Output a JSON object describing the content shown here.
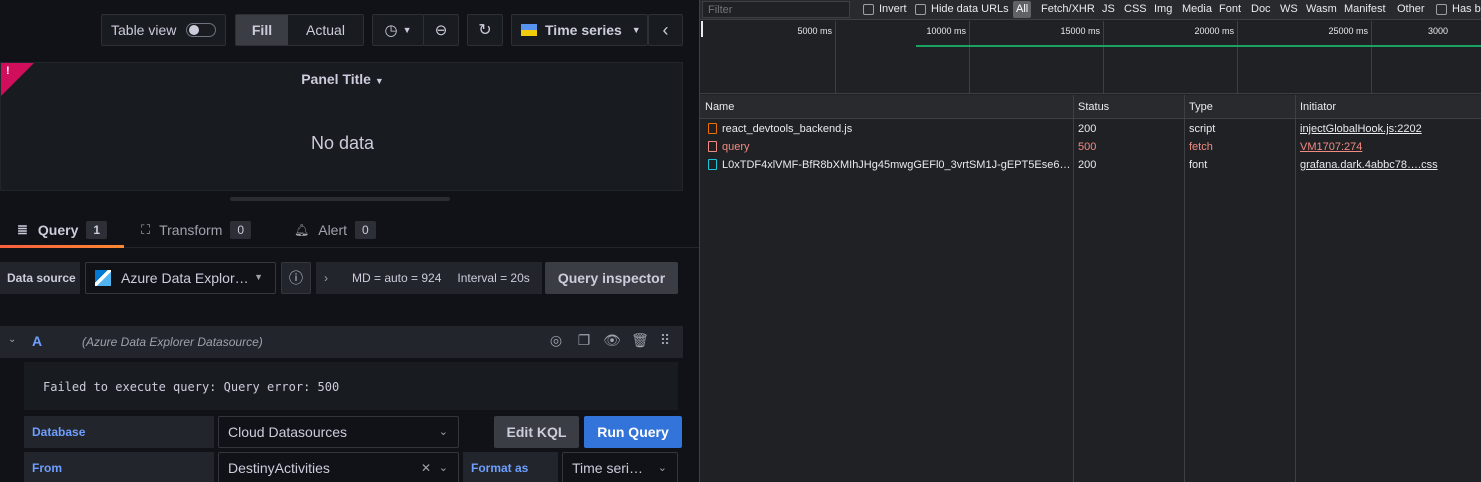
{
  "grafana": {
    "toolbar": {
      "table_view_label": "Table view",
      "fill_label": "Fill",
      "actual_label": "Actual",
      "viz_label": "Time series",
      "chevron_left": "‹"
    },
    "panel": {
      "error_mark": "!",
      "title": "Panel Title",
      "no_data": "No data"
    },
    "tabs": [
      {
        "label": "Query",
        "count": "1"
      },
      {
        "label": "Transform",
        "count": "0"
      },
      {
        "label": "Alert",
        "count": "0"
      }
    ],
    "datasource": {
      "label": "Data source",
      "selected": "Azure Data Explor…",
      "md": "MD = auto = 924",
      "interval": "Interval = 20s",
      "query_inspector": "Query inspector"
    },
    "query_row": {
      "letter": "A",
      "datasource_name": "(Azure Data Explorer Datasource)"
    },
    "error_message": "Failed to execute query: Query error: 500",
    "fields": {
      "database_label": "Database",
      "database_value": "Cloud Datasources",
      "edit_kql": "Edit KQL",
      "run_query": "Run Query",
      "from_label": "From",
      "from_value": "DestinyActivities",
      "clear_mark": "✕",
      "format_as_label": "Format as",
      "format_as_value": "Time seri…"
    },
    "colors": {
      "accent_blue": "#3274d9",
      "error_pink": "#d10e5c",
      "tab_orange": "#f55f3e"
    }
  },
  "devtools": {
    "filter": {
      "placeholder": "Filter",
      "invert": "Invert",
      "hide_data_urls": "Hide data URLs",
      "types": [
        "All",
        "Fetch/XHR",
        "JS",
        "CSS",
        "Img",
        "Media",
        "Font",
        "Doc",
        "WS",
        "Wasm",
        "Manifest",
        "Other"
      ],
      "has_blocked": "Has bl"
    },
    "timeline": {
      "ticks": [
        "5000 ms",
        "10000 ms",
        "15000 ms",
        "20000 ms",
        "25000 ms",
        "3000"
      ]
    },
    "table": {
      "headers": [
        "Name",
        "Status",
        "Type",
        "Initiator"
      ],
      "rows": [
        {
          "name": "react_devtools_backend.js",
          "status": "200",
          "type": "script",
          "initiator": "injectGlobalHook.js:2202",
          "icon": "script-icon",
          "error": false
        },
        {
          "name": "query",
          "status": "500",
          "type": "fetch",
          "initiator": "VM1707:274",
          "icon": "fetch-icon",
          "error": true
        },
        {
          "name": "L0xTDF4xlVMF-BfR8bXMIhJHg45mwgGEFl0_3vrtSM1J-gEPT5Ese6…",
          "status": "200",
          "type": "font",
          "initiator": "grafana.dark.4abbc78….css",
          "icon": "font-icon",
          "error": false
        }
      ]
    }
  }
}
